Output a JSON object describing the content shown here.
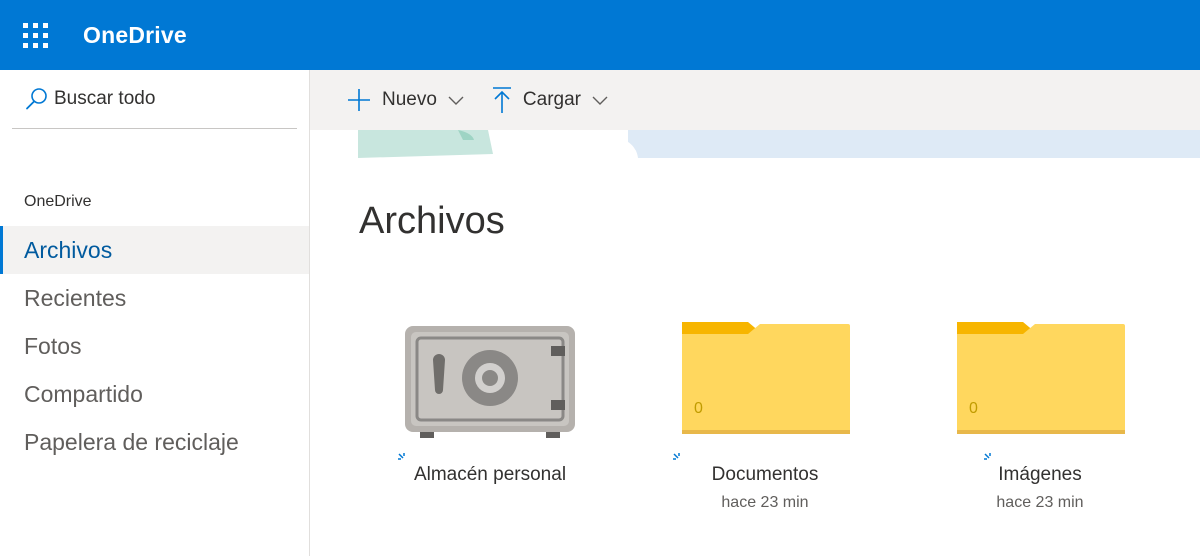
{
  "header": {
    "app_title": "OneDrive",
    "accent_color": "#0078d4",
    "launcher_icon": "waffle-icon"
  },
  "sidebar": {
    "search": {
      "placeholder": "Buscar todo",
      "value": "",
      "icon": "search-icon"
    },
    "section_title": "OneDrive",
    "items": [
      {
        "label": "Archivos",
        "active": true
      },
      {
        "label": "Recientes",
        "active": false
      },
      {
        "label": "Fotos",
        "active": false
      },
      {
        "label": "Compartido",
        "active": false
      },
      {
        "label": "Papelera de reciclaje",
        "active": false
      }
    ]
  },
  "toolbar": {
    "new_label": "Nuevo",
    "upload_label": "Cargar",
    "new_icon": "plus-icon",
    "upload_icon": "upload-arrow-icon",
    "dropdown_icon": "chevron-down-icon"
  },
  "main": {
    "title": "Archivos",
    "tiles": [
      {
        "name": "Almacén personal",
        "subtitle": "",
        "kind": "vault",
        "icon": "vault-icon"
      },
      {
        "name": "Documentos",
        "subtitle": "hace 23 min",
        "kind": "folder",
        "count": "0",
        "icon": "folder-icon"
      },
      {
        "name": "Imágenes",
        "subtitle": "hace 23 min",
        "kind": "folder",
        "count": "0",
        "icon": "folder-icon"
      }
    ]
  },
  "colors": {
    "folder_tab": "#f7b500",
    "folder_body": "#ffd75e",
    "selected_nav_bg": "#f3f2f1",
    "selected_nav_text": "#005a9e",
    "new_item_indicator": "#0078d4"
  }
}
